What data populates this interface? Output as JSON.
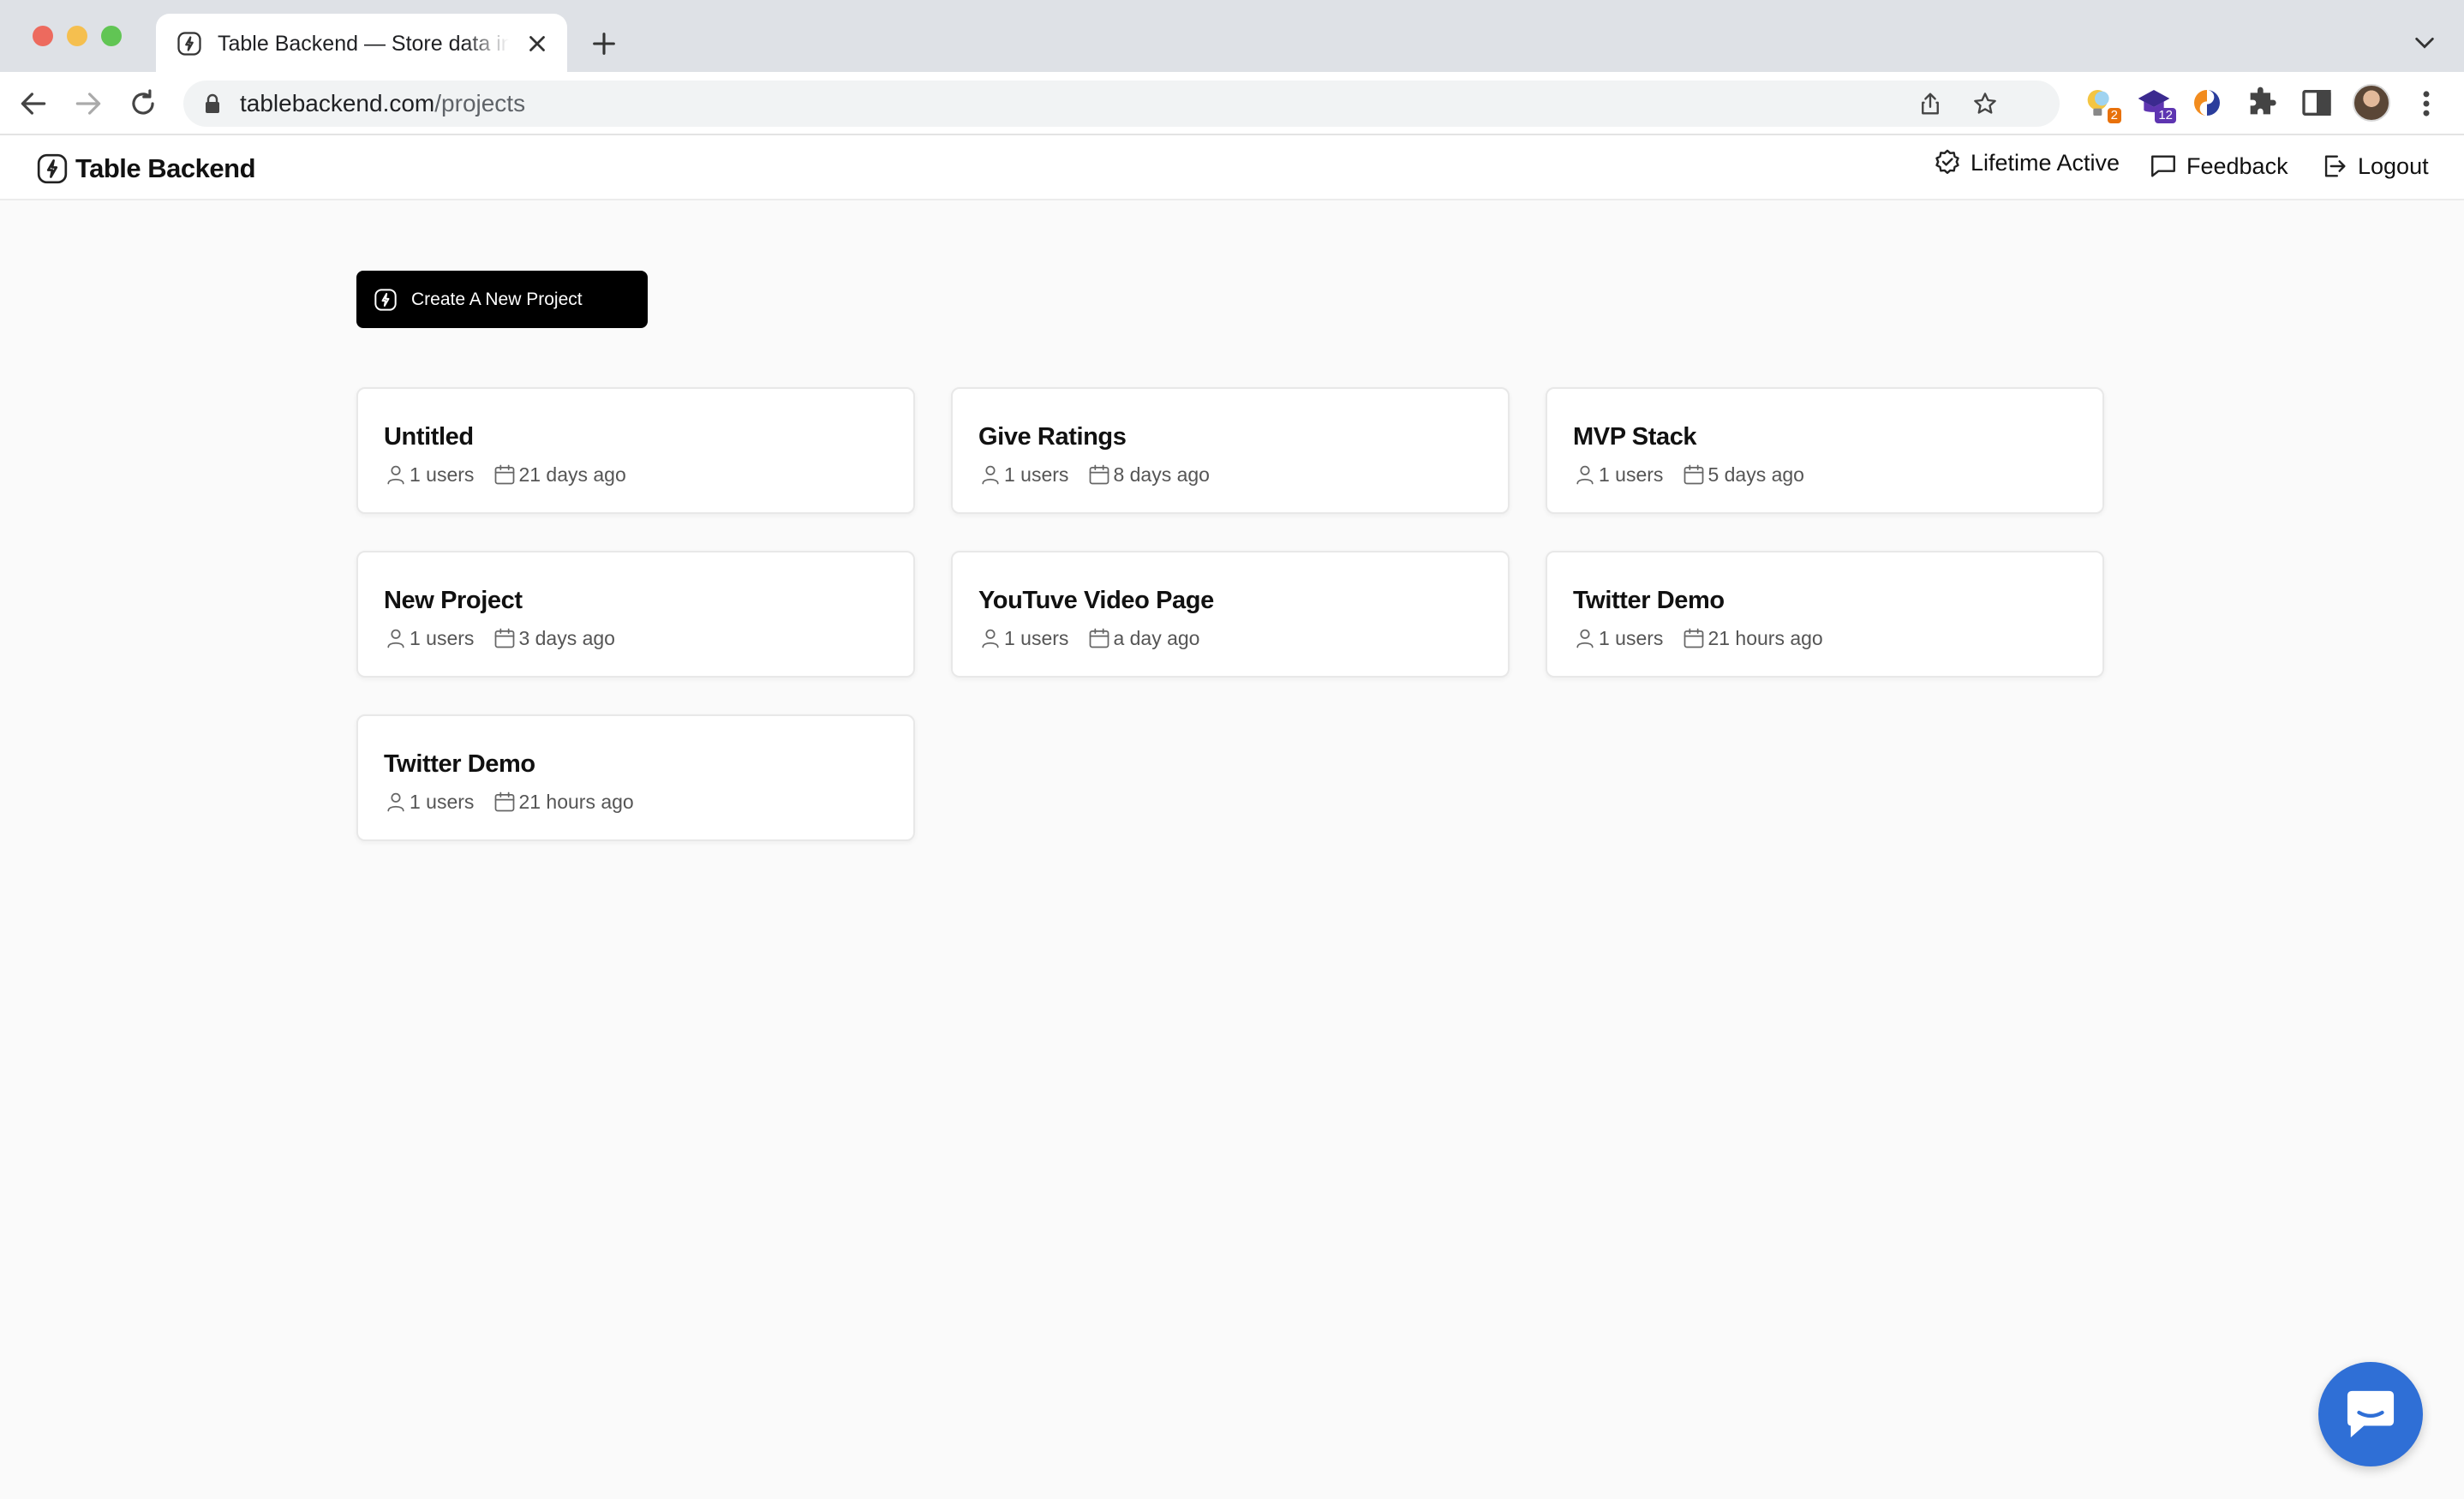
{
  "browser": {
    "tab_title": "Table Backend — Store data into tables",
    "url_domain": "tablebackend.com",
    "url_path": "/projects",
    "extensions": [
      {
        "icon": "lightbulb-extension-icon",
        "badge": "2",
        "badge_color": "#e8710a"
      },
      {
        "icon": "graduation-cap-extension-icon",
        "badge": "12",
        "badge_color": "#5e35b1"
      },
      {
        "icon": "color-swirl-extension-icon",
        "badge": ""
      },
      {
        "icon": "puzzle-extensions-icon",
        "badge": ""
      }
    ]
  },
  "header": {
    "app_name": "Table Backend",
    "lifetime_label": "Lifetime Active",
    "feedback_label": "Feedback",
    "logout_label": "Logout"
  },
  "main": {
    "create_button_label": "Create A New Project",
    "projects": [
      {
        "name": "Untitled",
        "users": "1 users",
        "date": "21 days ago"
      },
      {
        "name": "Give Ratings",
        "users": "1 users",
        "date": "8 days ago"
      },
      {
        "name": "MVP Stack",
        "users": "1 users",
        "date": "5 days ago"
      },
      {
        "name": "New Project",
        "users": "1 users",
        "date": "3 days ago"
      },
      {
        "name": "YouTuve Video Page",
        "users": "1 users",
        "date": "a day ago"
      },
      {
        "name": "Twitter Demo",
        "users": "1 users",
        "date": "21 hours ago"
      },
      {
        "name": "Twitter Demo",
        "users": "1 users",
        "date": "21 hours ago"
      }
    ]
  },
  "colors": {
    "accent_button": "#000000",
    "chat_bubble": "#2f6fd6",
    "page_background": "#fafafa"
  }
}
